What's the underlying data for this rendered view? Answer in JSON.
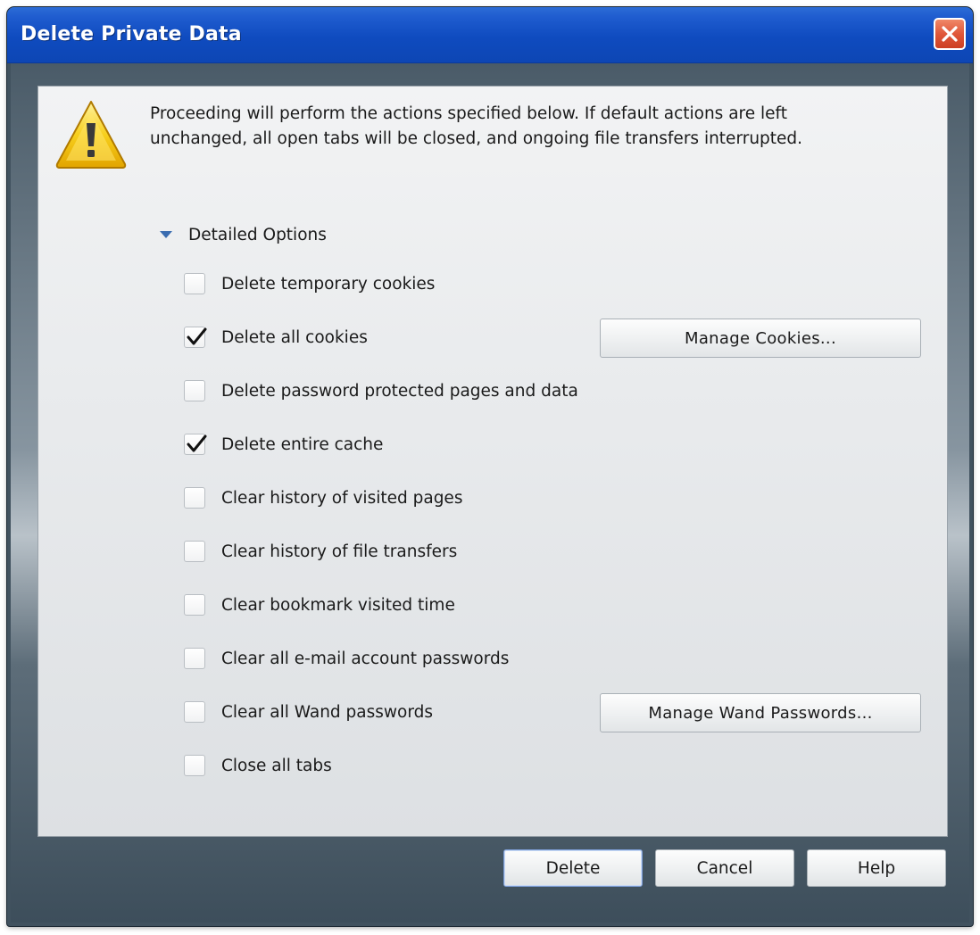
{
  "window": {
    "title": "Delete Private Data"
  },
  "message": "Proceeding will perform the actions specified below. If default actions are left unchanged, all open tabs will be closed, and ongoing file transfers interrupted.",
  "detailed_options": {
    "label": "Detailed Options",
    "expanded": true
  },
  "options": [
    {
      "label": "Delete temporary cookies",
      "checked": false
    },
    {
      "label": "Delete all cookies",
      "checked": true
    },
    {
      "label": "Delete password protected pages and data",
      "checked": false
    },
    {
      "label": "Delete entire cache",
      "checked": true
    },
    {
      "label": "Clear history of visited pages",
      "checked": false
    },
    {
      "label": "Clear history of file transfers",
      "checked": false
    },
    {
      "label": "Clear bookmark visited time",
      "checked": false
    },
    {
      "label": "Clear all e-mail account passwords",
      "checked": false
    },
    {
      "label": "Clear all Wand passwords",
      "checked": false
    },
    {
      "label": "Close all tabs",
      "checked": false
    }
  ],
  "buttons": {
    "manage_cookies": "Manage Cookies...",
    "manage_wand": "Manage Wand Passwords...",
    "delete": "Delete",
    "cancel": "Cancel",
    "help": "Help"
  },
  "icons": {
    "close": "close-icon",
    "warning": "warning-icon",
    "expand": "triangle-down-icon",
    "check": "checkmark-icon"
  },
  "colors": {
    "titlebar": "#0f4bbf",
    "close_button": "#e0573a",
    "warning_yellow": "#f5c400",
    "accent_triangle": "#3a6cb0"
  }
}
